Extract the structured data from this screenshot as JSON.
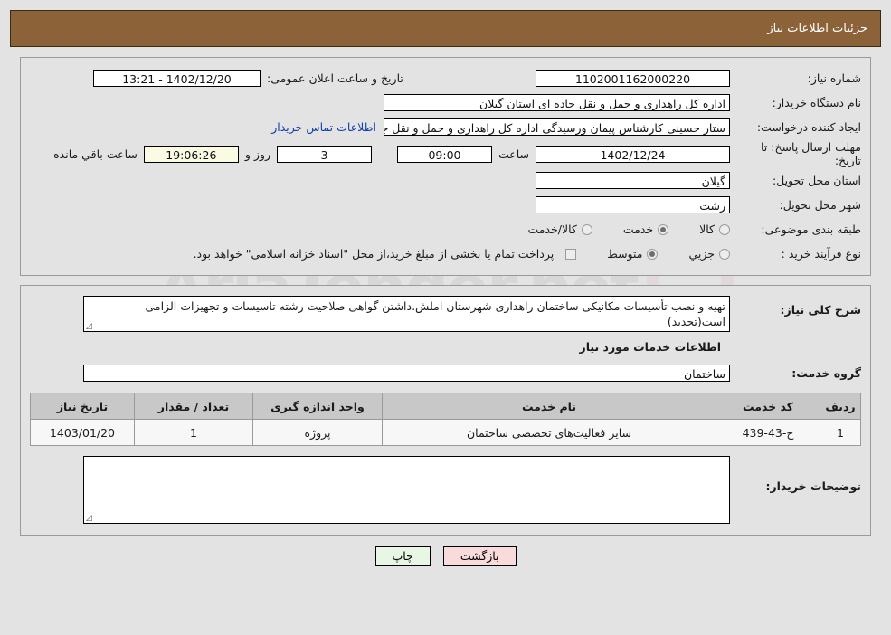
{
  "header": {
    "title": "جزئیات اطلاعات نیاز"
  },
  "form": {
    "need_number": {
      "label": "شماره نیاز:",
      "value": "1102001162000220"
    },
    "public_announce": {
      "label": "تاریخ و ساعت اعلان عمومی:",
      "value": "1402/12/20 - 13:21"
    },
    "buyer_org": {
      "label": "نام دستگاه خریدار:",
      "value": "اداره کل راهداری و حمل و نقل جاده ای استان گیلان"
    },
    "requester": {
      "label": "ایجاد کننده درخواست:",
      "value": "ستار حسینی کارشناس پیمان ورسیدگی اداره کل راهداری و حمل و نقل جاده ای",
      "contact_link": "اطلاعات تماس خریدار"
    },
    "deadline": {
      "label": "مهلت ارسال پاسخ: تا تاریخ:",
      "date": "1402/12/24",
      "time_label": "ساعت",
      "time": "09:00",
      "days": "3",
      "days_label": "روز و",
      "remaining": "19:06:26",
      "remaining_label": "ساعت باقي مانده"
    },
    "province": {
      "label": "استان محل تحویل:",
      "value": "گیلان"
    },
    "city": {
      "label": "شهر محل تحویل:",
      "value": "رشت"
    },
    "category": {
      "label": "طبقه بندی موضوعی:",
      "options": [
        {
          "label": "کالا",
          "selected": false
        },
        {
          "label": "خدمت",
          "selected": true
        },
        {
          "label": "کالا/خدمت",
          "selected": false
        }
      ]
    },
    "process_type": {
      "label": "نوع فرآیند خرید :",
      "options": [
        {
          "label": "جزیي",
          "selected": false
        },
        {
          "label": "متوسط",
          "selected": true
        }
      ],
      "checkbox_label": "پرداخت تمام یا بخشی از مبلغ خرید،از محل \"اسناد خزانه اسلامی\" خواهد بود.",
      "checkbox_checked": false
    }
  },
  "description": {
    "label": "شرح کلی نیاز:",
    "value": "تهیه و نصب تأسیسات مکانیکی ساختمان راهداری شهرستان املش.داشتن گواهی صلاحیت رشته تاسیسات و تجهیزات الزامی است(تجدید)"
  },
  "services_section": {
    "title": "اطلاعات خدمات مورد نیاز",
    "service_group": {
      "label": "گروه خدمت:",
      "value": "ساختمان"
    },
    "table": {
      "columns": [
        "ردیف",
        "کد خدمت",
        "نام خدمت",
        "واحد اندازه گیری",
        "تعداد / مقدار",
        "تاریخ نیاز"
      ],
      "rows": [
        {
          "row_no": "1",
          "service_code": "ج-43-439",
          "service_name": "سایر فعالیت‌های تخصصی ساختمان",
          "unit": "پروژه",
          "quantity": "1",
          "need_date": "1403/01/20"
        }
      ]
    }
  },
  "buyer_notes": {
    "label": "توضیحات خریدار:",
    "value": ""
  },
  "footer": {
    "back_label": "بازگشت",
    "print_label": "چاپ"
  },
  "watermark": {
    "text": "AriaTender.net"
  },
  "colors": {
    "header_bg": "#8c6239",
    "page_bg": "#e3e3e3",
    "link": "#1240ab",
    "highlight_field": "#fbfae2",
    "back_btn": "#fadbdb",
    "print_btn": "#e8f7e4",
    "table_header": "#c8c8c8"
  }
}
